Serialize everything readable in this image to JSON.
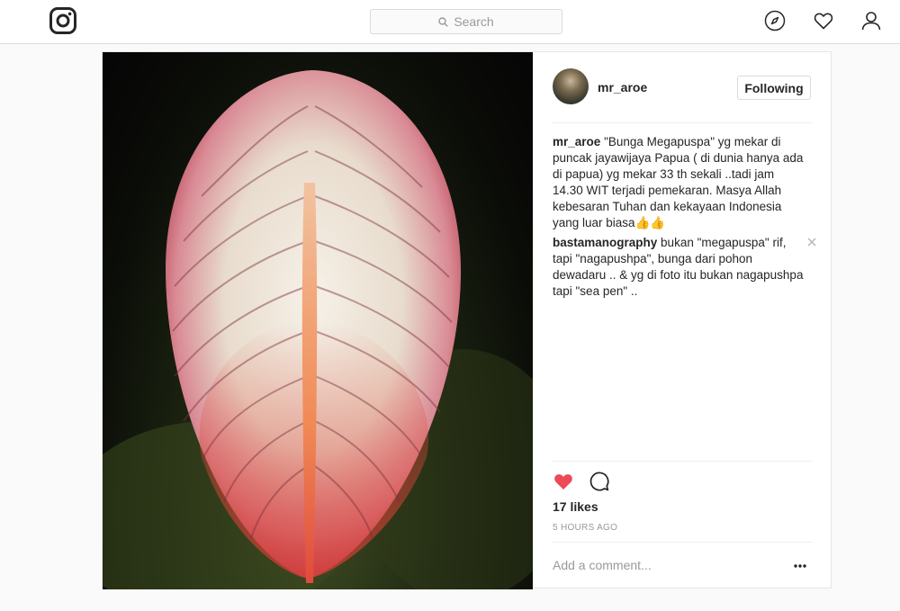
{
  "search": {
    "placeholder": "Search"
  },
  "post": {
    "username": "mr_aroe",
    "follow_label": "Following",
    "comments": [
      {
        "user": "mr_aroe",
        "text": "\"Bunga Megapuspa\" yg mekar di puncak jayawijaya Papua ( di dunia hanya ada di papua) yg mekar 33 th sekali ..tadi jam 14.30 WIT terjadi pemekaran. Masya Allah kebesaran Tuhan dan kekayaan Indonesia yang luar biasa👍👍"
      },
      {
        "user": "bastamanography",
        "text": "bukan \"megapuspa\" rif, tapi \"nagapushpa\", bunga dari pohon dewadaru .. & yg di foto itu bukan nagapushpa tapi \"sea pen\" .."
      }
    ],
    "likes": "17 likes",
    "time": "5 HOURS AGO",
    "add_comment_placeholder": "Add a comment...",
    "liked": true
  },
  "colors": {
    "like_red": "#ed4956",
    "border": "#dbdbdb",
    "muted": "#999999",
    "text": "#262626"
  },
  "icons": {
    "logo": "instagram-logo-icon",
    "search": "search-icon",
    "explore": "compass-icon",
    "activity": "heart-icon",
    "profile": "user-icon",
    "like": "heart-filled-icon",
    "comment": "speech-bubble-icon",
    "more": "ellipsis-icon",
    "delete_comment": "close-icon"
  }
}
